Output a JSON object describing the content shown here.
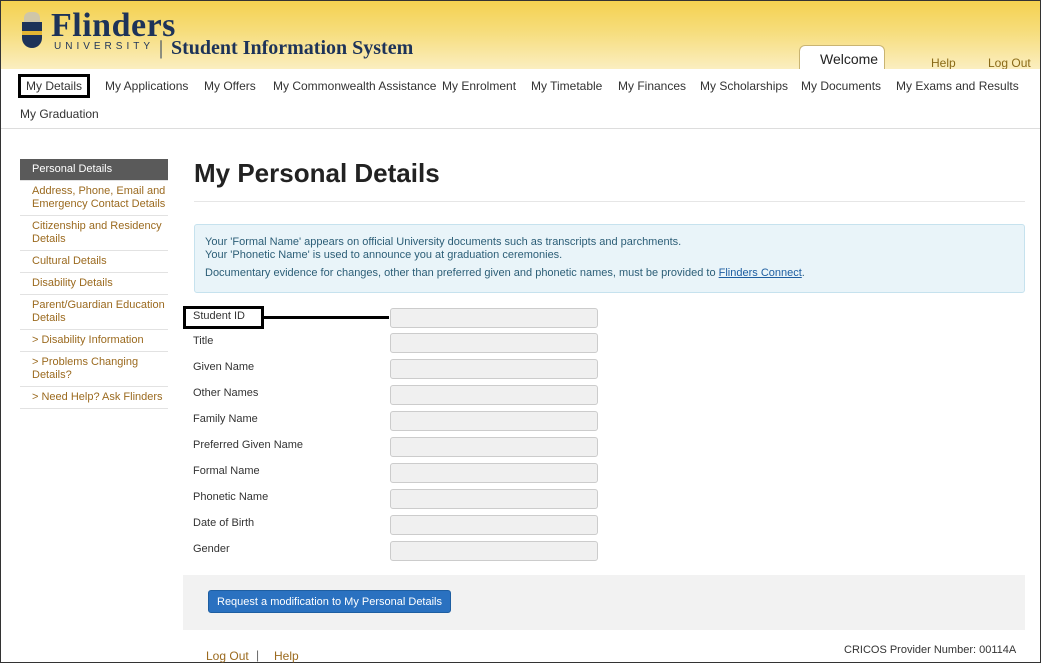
{
  "header": {
    "logo_name": "Flinders",
    "logo_sub": "UNIVERSITY",
    "separator": "|",
    "system_title": "Student Information System",
    "welcome": "Welcome",
    "help": "Help",
    "logout": "Log Out",
    "brand_color": "#1d3359",
    "banner_color": "#f4d150"
  },
  "nav": {
    "items": [
      {
        "label": "My Details",
        "active": true
      },
      {
        "label": "My Applications"
      },
      {
        "label": "My Offers"
      },
      {
        "label": "My Commonwealth Assistance"
      },
      {
        "label": "My Enrolment"
      },
      {
        "label": "My Timetable"
      },
      {
        "label": "My Finances"
      },
      {
        "label": "My Scholarships"
      },
      {
        "label": "My Documents"
      },
      {
        "label": "My Exams and Results"
      },
      {
        "label": "My Graduation"
      }
    ]
  },
  "sidebar": {
    "items": [
      {
        "label": "Personal Details",
        "active": true
      },
      {
        "label": "Address, Phone, Email and Emergency Contact Details"
      },
      {
        "label": "Citizenship and Residency Details"
      },
      {
        "label": "Cultural Details"
      },
      {
        "label": "Disability Details"
      },
      {
        "label": "Parent/Guardian Education Details"
      },
      {
        "label": "> Disability Information"
      },
      {
        "label": "> Problems Changing Details?"
      },
      {
        "label": "> Need Help? Ask Flinders"
      }
    ]
  },
  "main": {
    "title": "My Personal Details",
    "info": {
      "line1": "Your 'Formal Name' appears on official University documents such as transcripts and parchments.",
      "line2": "Your 'Phonetic Name' is used to announce you at graduation ceremonies.",
      "line3_prefix": "Documentary evidence for changes, other than preferred given and phonetic names, must be provided to ",
      "line3_link": "Flinders Connect",
      "line3_suffix": "."
    },
    "fields": [
      {
        "label": "Student ID",
        "value": ""
      },
      {
        "label": "Title",
        "value": ""
      },
      {
        "label": "Given Name",
        "value": ""
      },
      {
        "label": "Other Names",
        "value": ""
      },
      {
        "label": "Family Name",
        "value": ""
      },
      {
        "label": "Preferred Given Name",
        "value": ""
      },
      {
        "label": "Formal Name",
        "value": ""
      },
      {
        "label": "Phonetic Name",
        "value": ""
      },
      {
        "label": "Date of Birth",
        "value": ""
      },
      {
        "label": "Gender",
        "value": ""
      }
    ],
    "request_button": "Request a modification to My Personal Details"
  },
  "footer": {
    "logout": "Log Out",
    "separator": "|",
    "help": "Help",
    "cricos": "CRICOS Provider Number: 00114A"
  }
}
